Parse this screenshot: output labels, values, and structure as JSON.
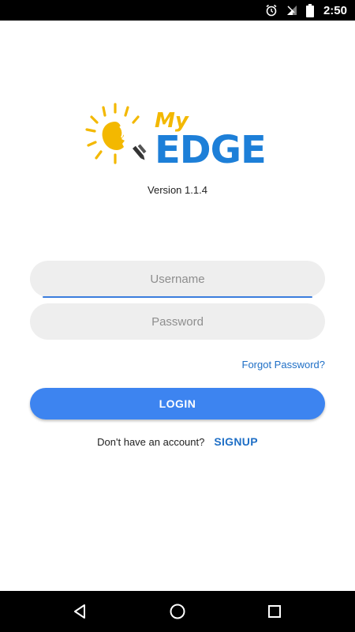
{
  "status_bar": {
    "time": "2:50",
    "icons": [
      "alarm-icon",
      "signal-icon",
      "battery-icon"
    ]
  },
  "logo": {
    "my_text": "My",
    "edge_text": "EDGE",
    "colors": {
      "sun": "#f3b800",
      "edge": "#1d7fd8",
      "pencil": "#333333"
    }
  },
  "version": "Version 1.1.4",
  "form": {
    "username_placeholder": "Username",
    "username_value": "",
    "password_placeholder": "Password",
    "password_value": "",
    "forgot_password": "Forgot Password?",
    "login_label": "LOGIN"
  },
  "signup": {
    "question": "Don't have an account?",
    "link": "SIGNUP"
  },
  "nav_bar": {
    "buttons": [
      "back-icon",
      "home-icon",
      "recents-icon"
    ]
  },
  "colors": {
    "accent": "#3d84f0",
    "link": "#1f6fc6",
    "field_bg": "#eeeeee"
  }
}
